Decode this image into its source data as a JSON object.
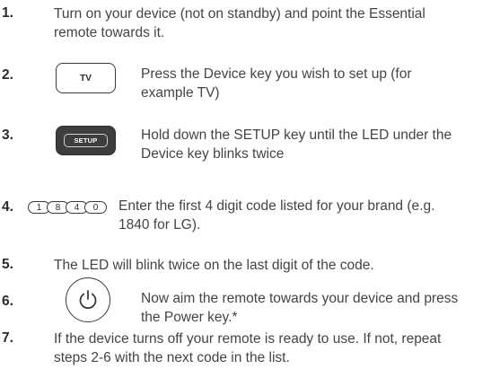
{
  "steps": [
    {
      "number": "1.",
      "lines": [
        "Turn on your device (not on standby) and point the Essential",
        "remote towards it."
      ]
    },
    {
      "number": "2.",
      "key_label": "TV",
      "lines": [
        "Press the Device key you wish to set up (for",
        "example TV)"
      ]
    },
    {
      "number": "3.",
      "key_label": "SETUP",
      "lines": [
        "Hold down the SETUP key until the LED under the",
        "Device key blinks twice"
      ]
    },
    {
      "number": "4.",
      "digits": [
        "1",
        "8",
        "4",
        "0"
      ],
      "lines": [
        "Enter the first 4 digit code listed for your brand (e.g.",
        "1840 for LG)."
      ]
    },
    {
      "number": "5.",
      "lines": [
        "The LED will blink twice on the last digit of the code."
      ]
    },
    {
      "number": "6.",
      "icon": "power-icon",
      "lines": [
        "Now aim the remote towards your device and press",
        "the Power key.*"
      ]
    },
    {
      "number": "7.",
      "lines": [
        "If the device turns off your remote is ready to use. If not, repeat",
        "steps 2-6 with the next code in the list."
      ]
    }
  ]
}
